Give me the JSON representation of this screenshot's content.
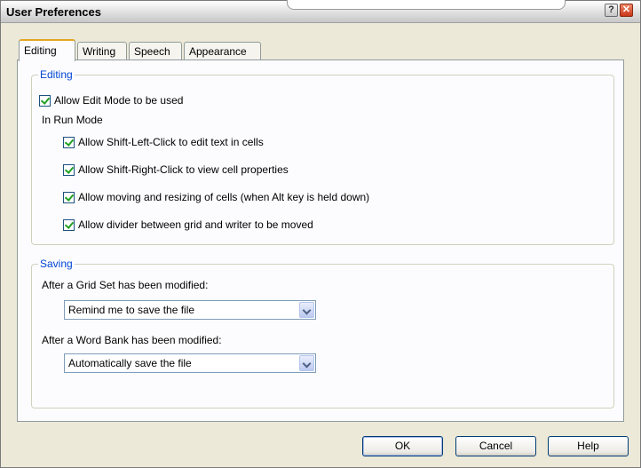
{
  "window": {
    "title": "User Preferences",
    "help_glyph": "?",
    "close_glyph": "✕"
  },
  "tabs": [
    {
      "label": "Editing",
      "active": true
    },
    {
      "label": "Writing",
      "active": false
    },
    {
      "label": "Speech",
      "active": false
    },
    {
      "label": "Appearance",
      "active": false
    }
  ],
  "editing_group": {
    "title": "Editing",
    "allow_edit_mode": {
      "label": "Allow Edit Mode to be used",
      "checked": true
    },
    "run_mode_label": "In Run Mode",
    "run_mode_options": [
      {
        "label": "Allow Shift-Left-Click to edit text in cells",
        "checked": true
      },
      {
        "label": "Allow Shift-Right-Click to view cell properties",
        "checked": true
      },
      {
        "label": "Allow moving and resizing of cells (when Alt key is held down)",
        "checked": true
      },
      {
        "label": "Allow divider between grid and writer to be moved",
        "checked": true
      }
    ]
  },
  "saving_group": {
    "title": "Saving",
    "grid_set_label": "After a Grid Set has been modified:",
    "grid_set_value": "Remind me to save the file",
    "word_bank_label": "After a Word Bank has been modified:",
    "word_bank_value": "Automatically save the file"
  },
  "buttons": {
    "ok": "OK",
    "cancel": "Cancel",
    "help": "Help"
  },
  "colors": {
    "group_title": "#0046d5",
    "active_tab_accent": "#e5a523",
    "dialog_face": "#ece9d8"
  },
  "icons": [
    "help-icon",
    "close-icon",
    "checkbox-checked-icon",
    "dropdown-arrow-icon"
  ]
}
